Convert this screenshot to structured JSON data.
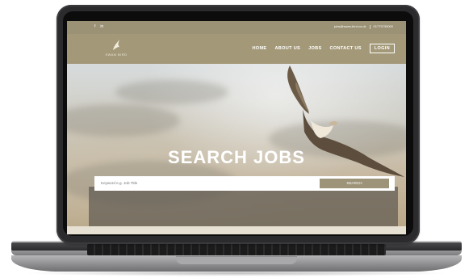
{
  "topbar": {
    "social": [
      "f",
      "in"
    ],
    "email": "jobs@swan-bird.co.uk",
    "phone": "01773730000"
  },
  "brand": {
    "name": "SWAN BIRD"
  },
  "nav": {
    "links": [
      "HOME",
      "ABOUT US",
      "JOBS",
      "CONTACT US"
    ],
    "login": "LOGIN"
  },
  "hero": {
    "title": "SEARCH JOBS",
    "search_placeholder": "Keyword e.g. Job Title",
    "search_button": "SEARCH"
  },
  "colors": {
    "brand_bar": "#a39878",
    "top_bar": "#9b9275",
    "button": "#9d9378"
  }
}
